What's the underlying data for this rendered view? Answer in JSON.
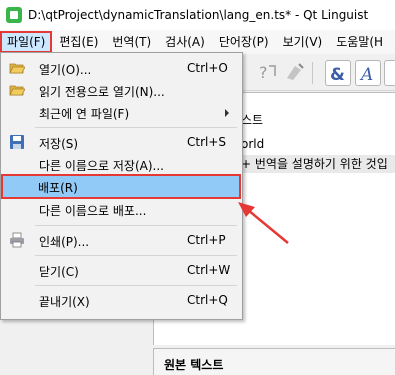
{
  "window": {
    "title": "D:\\qtProject\\dynamicTranslation\\lang_en.ts* - Qt Linguist",
    "app_icon": "qt-linguist-icon"
  },
  "menubar": {
    "items": [
      {
        "label": "파일(F)"
      },
      {
        "label": "편집(E)"
      },
      {
        "label": "번역(T)"
      },
      {
        "label": "검사(A)"
      },
      {
        "label": "단어장(P)"
      },
      {
        "label": "보기(V)"
      },
      {
        "label": "도움말(H"
      }
    ]
  },
  "file_menu": {
    "items": [
      {
        "label": "열기(O)...",
        "shortcut": "Ctrl+O",
        "icon": "folder-open-icon"
      },
      {
        "label": "읽기 전용으로 열기(N)...",
        "shortcut": "",
        "icon": "folder-open-icon"
      },
      {
        "label": "최근에 연 파일(F)",
        "shortcut": "",
        "icon": "",
        "submenu": true
      },
      {
        "label": "저장(S)",
        "shortcut": "Ctrl+S",
        "icon": "save-icon"
      },
      {
        "label": "다른 이름으로 저장(A)...",
        "shortcut": "",
        "icon": ""
      },
      {
        "label": "배포(R)",
        "shortcut": "",
        "icon": "",
        "selected": true
      },
      {
        "label": "다른 이름으로 배포...",
        "shortcut": "",
        "icon": ""
      },
      {
        "label": "인쇄(P)...",
        "shortcut": "Ctrl+P",
        "icon": "print-icon"
      },
      {
        "label": "닫기(C)",
        "shortcut": "Ctrl+W",
        "icon": ""
      },
      {
        "label": "끝내기(X)",
        "shortcut": "Ctrl+Q",
        "icon": ""
      }
    ]
  },
  "background": {
    "pane_lines": [
      "스트",
      "orld",
      "+ 번역을 설명하기 위한 것입"
    ],
    "bottom_pane_label": "원본 텍스트"
  },
  "colors": {
    "highlight_red": "#e53935",
    "selection_blue": "#91c9f7",
    "menubar_active": "#cce8ff"
  }
}
